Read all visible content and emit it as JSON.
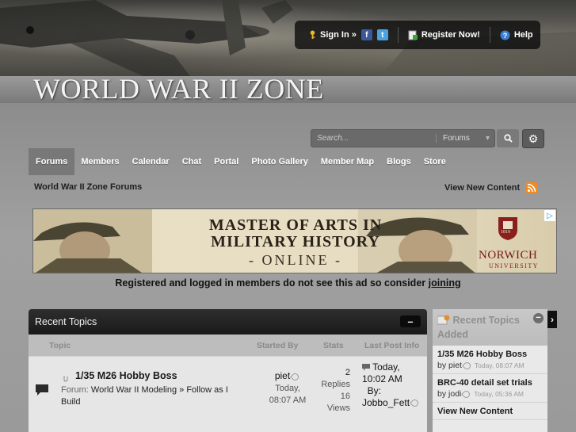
{
  "header": {
    "site_title": "WORLD WAR II ZONE",
    "userbar": {
      "sign_in": "Sign In »",
      "register": "Register Now!",
      "help": "Help"
    }
  },
  "search": {
    "placeholder": "Search...",
    "scope": "Forums"
  },
  "nav": {
    "tabs": [
      "Forums",
      "Members",
      "Calendar",
      "Chat",
      "Portal",
      "Photo Gallery",
      "Member Map",
      "Blogs",
      "Store"
    ],
    "active": "Forums"
  },
  "breadcrumb": "World War II Zone Forums",
  "view_new_content": "View New Content",
  "ad": {
    "line1": "MASTER OF ARTS IN",
    "line2": "MILITARY HISTORY",
    "line3": "- ONLINE -",
    "brand": "NORWICH",
    "brand_sub": "UNIVERSITY",
    "seal_year": "1819"
  },
  "ad_note": {
    "text": "Registered and logged in members do not see this ad so consider ",
    "link": "joining"
  },
  "recent_topics": {
    "title": "Recent Topics",
    "collapse": "–",
    "columns": {
      "topic": "Topic",
      "started_by": "Started By",
      "stats": "Stats",
      "last_post": "Last Post Info"
    },
    "rows": [
      {
        "title": "1/35 M26 Hobby Boss",
        "forum_prefix": "Forum:",
        "forum_path": "World War II Modeling » Follow as I Build",
        "starter": "piet",
        "started_date": "Today,",
        "started_time": "08:07 AM",
        "replies_count": "2",
        "replies_label": "Replies",
        "views_count": "16",
        "views_label": "Views",
        "last_date": "Today,",
        "last_time": "10:02 AM",
        "last_by": "By:",
        "last_user": "Jobbo_Fett"
      }
    ]
  },
  "sidebar": {
    "title": "Recent Topics Added",
    "items": [
      {
        "title": "1/35 M26 Hobby Boss",
        "by": "by",
        "user": "piet",
        "time": "Today, 08:07 AM"
      },
      {
        "title": "BRC-40 detail set trials",
        "by": "by",
        "user": "jodi",
        "time": "Today, 05:36 AM"
      },
      {
        "title": "View New Content"
      }
    ]
  },
  "colors": {
    "accent_dark": "#1a1a1a",
    "nav_active": "#787878",
    "rss": "#f08a24",
    "facebook": "#3b5998",
    "twitter": "#4aa3df"
  }
}
